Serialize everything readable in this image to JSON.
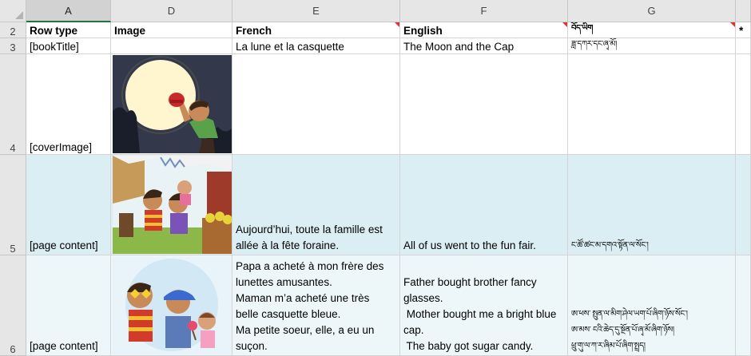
{
  "columns": [
    {
      "letter": "A",
      "selected": true
    },
    {
      "letter": "D"
    },
    {
      "letter": "E"
    },
    {
      "letter": "F"
    },
    {
      "letter": "G"
    },
    {
      "letter": ""
    }
  ],
  "rows": {
    "r2": {
      "num": "2",
      "a": "Row type",
      "d": "Image",
      "e": "French",
      "f": "English",
      "g": "བོད་ཡིག",
      "h": "*"
    },
    "r3": {
      "num": "3",
      "a": "[bookTitle]",
      "e": "La lune et la casquette",
      "f": "The Moon and the Cap",
      "g": "ཟླ་དཀར་དང་ཞྭ་མོ།"
    },
    "r4": {
      "num": "4",
      "a": "[coverImage]"
    },
    "r5": {
      "num": "5",
      "a": "[page content]",
      "e_lines": [
        "Aujourd’hui, toute la famille est",
        "allée à la fête foraine."
      ],
      "f": "All of us went to the fun fair.",
      "g": "ང་ཚོ་ཚང་མ་དགའ་སྟོན་ལ་སོང་།"
    },
    "r6": {
      "num": "6",
      "a": "[page content]",
      "e_lines": [
        "Papa a acheté à mon frère des",
        "lunettes amusantes.",
        "Maman m’a acheté une très",
        "belle casquette bleue.",
        "Ma petite soeur, elle, a eu un",
        "suçon."
      ],
      "f_lines": [
        "Father bought brother fancy",
        "glasses.",
        " Mother bought me a bright blue",
        "cap.",
        " The baby got sugar candy."
      ],
      "g_lines": [
        "ཨ་ཕས་ སྤུན་ལ་མིག་ཤེལ་ཡག་པོ་ཞིག་ཉོས་སོང་།",
        "ཨ་མས་ ངའི་ཆེད་དུ་སྔོན་པོ་ཞྭ་མོ་ཞིག་ཉོས།",
        "ཕྲུ་གུ་ལ་ཀ་ར་ཞིམ་པོ་ཞིག་སྤྲད།"
      ]
    }
  },
  "colors": {
    "accent": "#217346",
    "note": "#e03030",
    "teal": "#dbeef3"
  }
}
